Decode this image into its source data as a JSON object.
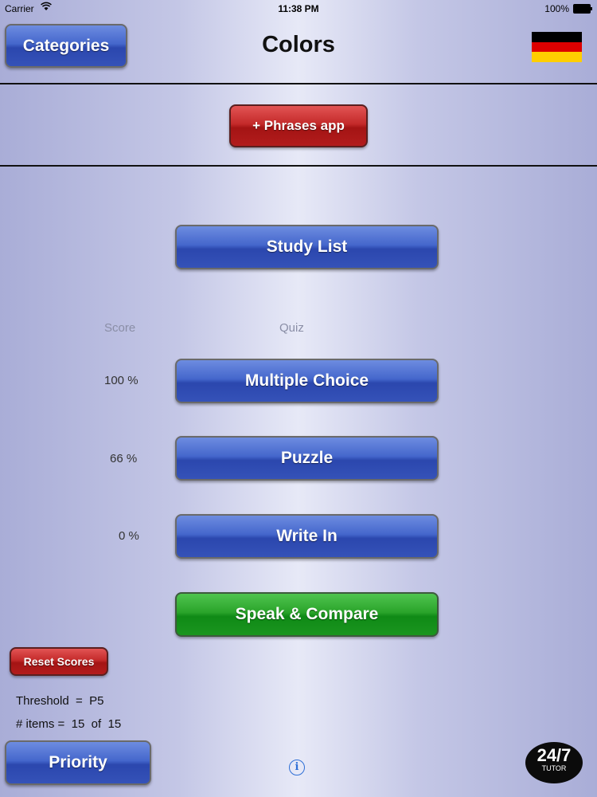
{
  "status_bar": {
    "carrier": "Carrier",
    "time": "11:38 PM",
    "battery": "100%"
  },
  "header": {
    "categories_button": "Categories",
    "title": "Colors",
    "flag": {
      "name": "germany-flag",
      "colors": [
        "#000000",
        "#dd0000",
        "#ffce00"
      ]
    }
  },
  "promo": {
    "phrases_button": "+ Phrases app"
  },
  "study": {
    "study_list_button": "Study List"
  },
  "quiz": {
    "score_header": "Score",
    "quiz_header": "Quiz",
    "items": [
      {
        "score": "100 %",
        "label": "Multiple Choice"
      },
      {
        "score": "66 %",
        "label": "Puzzle"
      },
      {
        "score": "0 %",
        "label": "Write In"
      }
    ],
    "speak_button": "Speak & Compare"
  },
  "footer": {
    "reset_button": "Reset Scores",
    "threshold": "Threshold  =  P5",
    "items_count": "# items =  15  of  15",
    "priority_button": "Priority",
    "info_icon": "i",
    "tutor_badge": {
      "big": "24/7",
      "small": "TUTOR"
    }
  },
  "colors": {
    "blue_button": "#3a57bf",
    "red_button": "#b51c1c",
    "green_button": "#1b951f"
  }
}
